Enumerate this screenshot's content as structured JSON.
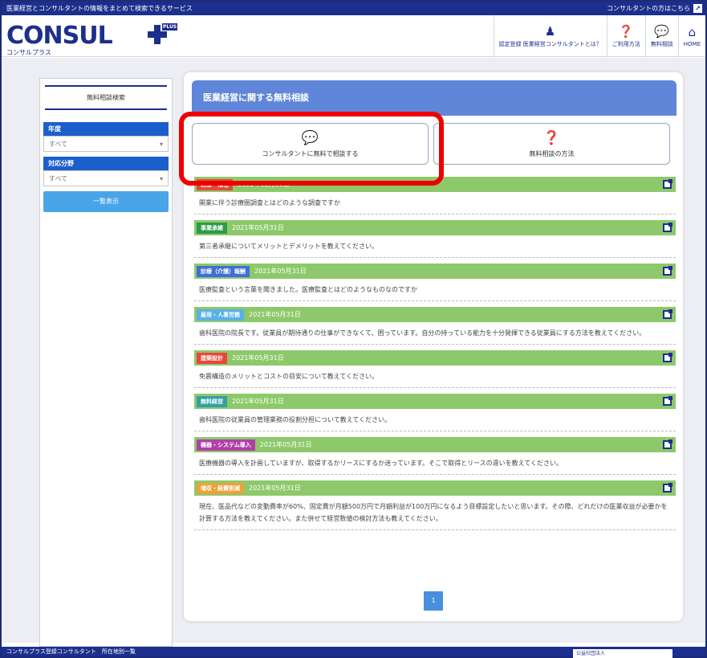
{
  "topbar": {
    "tagline": "医業経営とコンサルタントの情報をまとめて検索できるサービス",
    "consultant_link": "コンサルタントの方はこちら"
  },
  "header": {
    "logo_text": "CONSUL",
    "logo_plus_badge": "PLUS",
    "logo_sub": "コンサルプラス",
    "nav": [
      {
        "label": "認定登録 医業経営コンサルタントとは？",
        "icon": "person-icon"
      },
      {
        "label": "ご利用方法",
        "icon": "question-icon"
      },
      {
        "label": "無料相談",
        "icon": "chat-icon"
      },
      {
        "label": "HOME",
        "icon": "home-icon"
      }
    ]
  },
  "sidebar": {
    "title": "無料相談検索",
    "year_label": "年度",
    "year_value": "すべて",
    "field_label": "対応分野",
    "field_value": "すべて",
    "list_button": "一覧表示"
  },
  "main": {
    "heading": "医業経営に関する無料相談",
    "consult_button": "コンサルタントに無料で相談する",
    "method_button": "無料相談の方法",
    "items": [
      {
        "category": "医療・福祉",
        "color": "#e8473b",
        "date": "2021年05月31日",
        "text": "開業に伴う診療圏調査とはどのような調査ですか"
      },
      {
        "category": "事業承継",
        "color": "#2e9a4a",
        "date": "2021年05月31日",
        "text": "第三者承継についてメリットとデメリットを教えてください。"
      },
      {
        "category": "診療（介護）報酬",
        "color": "#3f6fd6",
        "date": "2021年05月31日",
        "text": "医療監査という言葉を聞きました。医療監査とはどのようなものなのですか"
      },
      {
        "category": "雇用・人事労務",
        "color": "#5ab0e6",
        "date": "2021年05月31日",
        "text": "歯科医院の院長です。従業員が期待通りの仕事ができなくて、困っています。自分の持っている能力を十分発揮できる従業員にする方法を教えてください。"
      },
      {
        "category": "建築設計",
        "color": "#e8473b",
        "date": "2021年05月31日",
        "text": "免震構造のメリットとコストの目安について教えてください。"
      },
      {
        "category": "無料経営",
        "color": "#34a0a4",
        "date": "2021年05月31日",
        "text": "歯科医院の従業員の管理業務の役割分担について教えてください。"
      },
      {
        "category": "機器・システム導入",
        "color": "#b23fa8",
        "date": "2021年05月31日",
        "text": "医療機器の導入を計画していますが、取得するかリースにするか迷っています。そこで取得とリースの違いを教えてください。"
      },
      {
        "category": "増収・経費削減",
        "color": "#e8a43b",
        "date": "2021年05月31日",
        "text": "現在、医品代などの変動費率が60%、固定費が月額500万円で月額利益が100万円になるよう目標設定したいと思います。その際、どれだけの医業収益が必要かを計算する方法を教えてください。また併せて経営数値の検討方法も教えてください。"
      }
    ],
    "page": "1"
  },
  "footer": {
    "text": "コンサルプラス登録コンサルタント　所在地別一覧",
    "org": "公益社団法人"
  }
}
